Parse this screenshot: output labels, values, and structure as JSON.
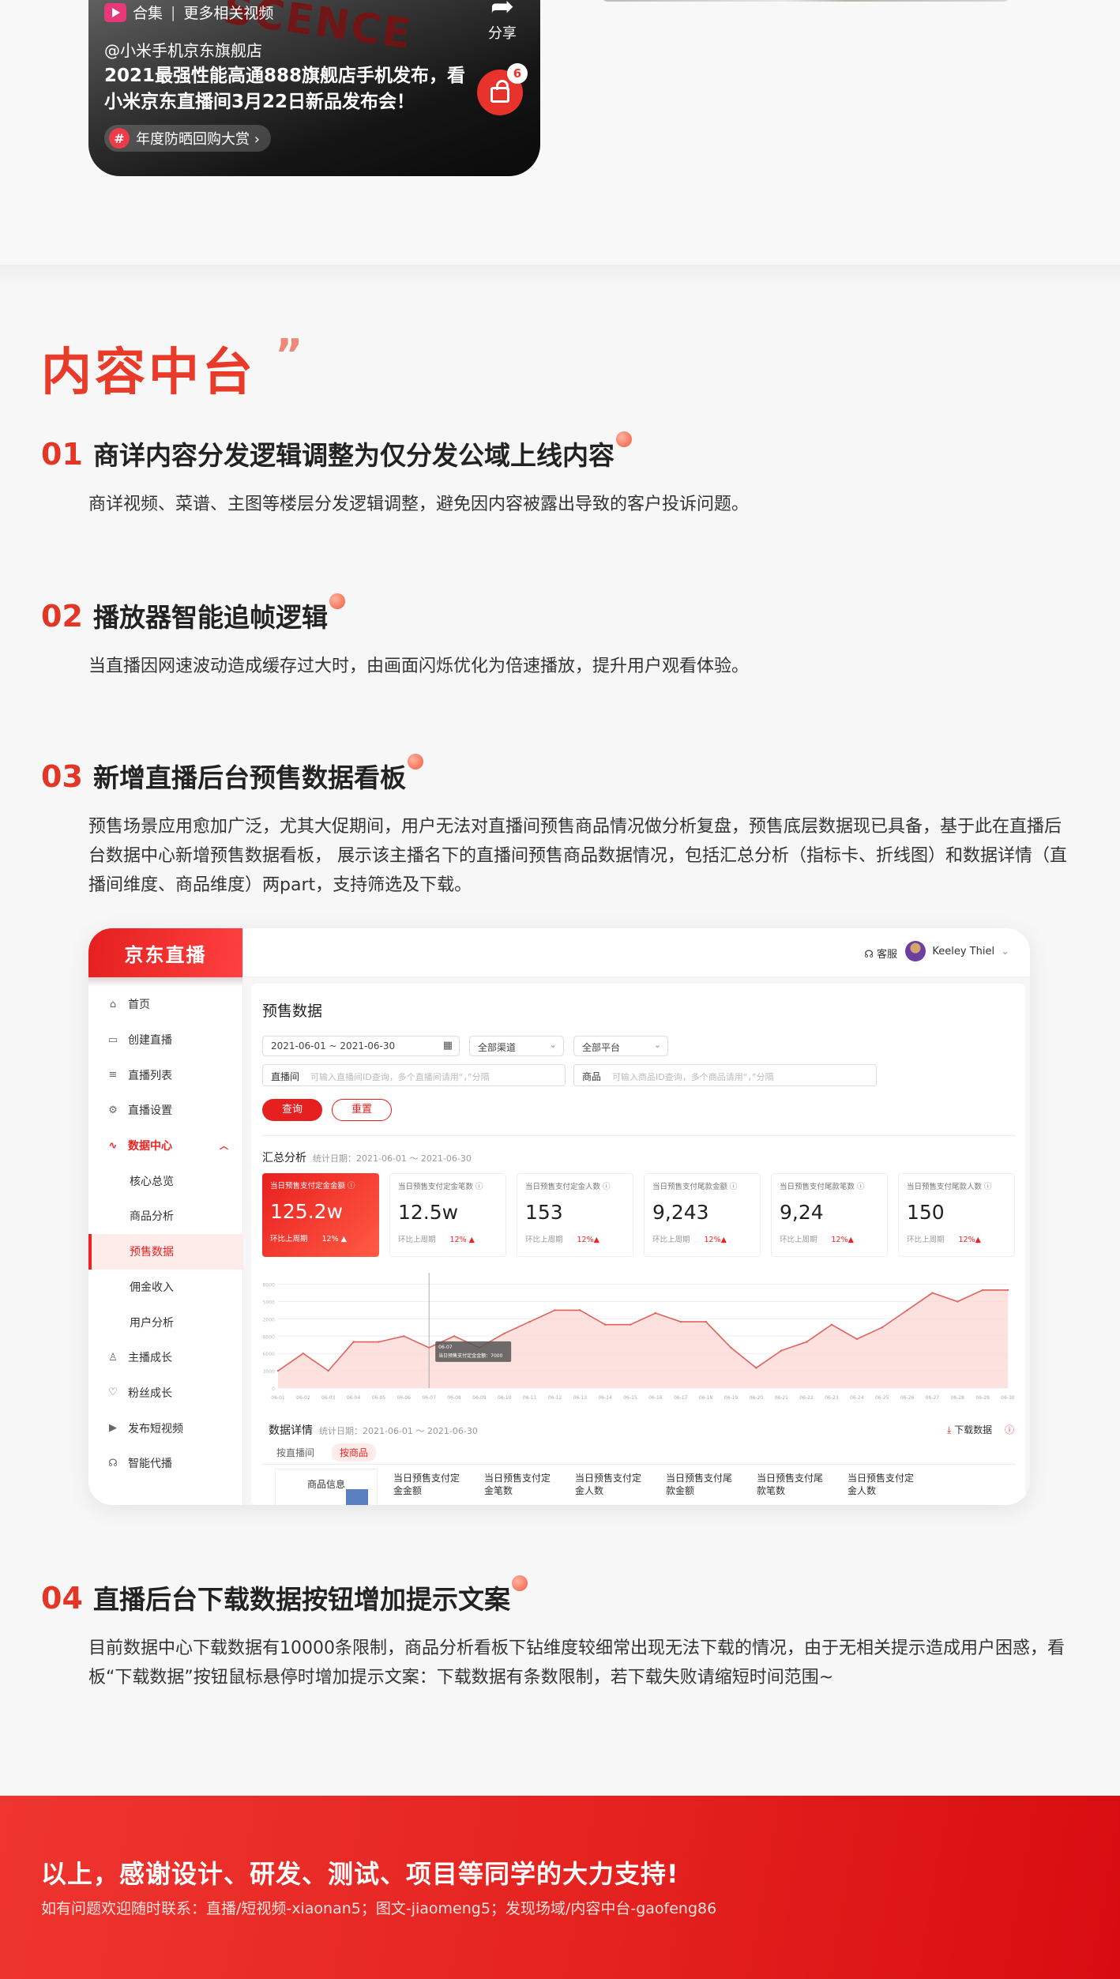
{
  "video_card": {
    "collection_label": "合集",
    "more_label": "更多相关视频",
    "bg_text": "SCENCE",
    "share_label": "分享",
    "author": "@小米手机京东旗舰店",
    "headline": "2021最强性能高通888旗舰店手机发布，看小米京东直播间3月22日新品发布会！",
    "cart_badge": "6",
    "topic_hash": "#",
    "topic_label": "年度防晒回购大赏 ›"
  },
  "section": {
    "title": "内容中台",
    "quote": "”"
  },
  "items": [
    {
      "num": "01",
      "title": "商详内容分发逻辑调整为仅分发公域上线内容",
      "body": "商详视频、菜谱、主图等楼层分发逻辑调整，避免因内容被露出导致的客户投诉问题。"
    },
    {
      "num": "02",
      "title": "播放器智能追帧逻辑",
      "body": "当直播因网速波动造成缓存过大时，由画面闪烁优化为倍速播放，提升用户观看体验。"
    },
    {
      "num": "03",
      "title": "新增直播后台预售数据看板",
      "body": "预售场景应用愈加广泛，尤其大促期间，用户无法对直播间预售商品情况做分析复盘，预售底层数据现已具备，基于此在直播后台数据中心新增预售数据看板， 展示该主播名下的直播间预售商品数据情况，包括汇总分析（指标卡、折线图）和数据详情（直播间维度、商品维度）两part，支持筛选及下载。"
    },
    {
      "num": "04",
      "title": "直播后台下载数据按钮增加提示文案",
      "body": "目前数据中心下载数据有10000条限制，商品分析看板下钻维度较细常出现无法下载的情况，由于无相关提示造成用户困惑，看板“下载数据”按钮鼠标悬停时增加提示文案：下载数据有条数限制，若下载失败请缩短时间范围~"
    }
  ],
  "dashboard": {
    "logo": "京东直播",
    "nav": [
      {
        "icon": "⌂",
        "label": "首页"
      },
      {
        "icon": "▭",
        "label": "创建直播"
      },
      {
        "icon": "≡",
        "label": "直播列表"
      },
      {
        "icon": "⚙",
        "label": "直播设置"
      },
      {
        "icon": "∿",
        "label": "数据中心",
        "caret": "︿"
      },
      {
        "label": "核心总览"
      },
      {
        "label": "商品分析"
      },
      {
        "label": "预售数据"
      },
      {
        "label": "佣金收入"
      },
      {
        "label": "用户分析"
      },
      {
        "icon": "♙",
        "label": "主播成长"
      },
      {
        "icon": "♡",
        "label": "粉丝成长"
      },
      {
        "icon": "▶",
        "label": "发布短视频"
      },
      {
        "icon": "☊",
        "label": "智能代播"
      }
    ],
    "help": "☊ 客服",
    "user": "Keeley Thiel",
    "user_caret": "⌄",
    "page_title": "预售数据",
    "date_range": "2021-06-01 ~ 2021-06-30",
    "date_icon": "▦",
    "channel": "全部渠道",
    "platform": "全部平台",
    "dropdown_icon": "⌄",
    "room_label": "直播间",
    "room_placeholder": "可输入直播间ID查询，多个直播间请用“，”分隔",
    "goods_label": "商品",
    "goods_placeholder": "可输入商品ID查询，多个商品请用“，”分隔",
    "query_btn": "查询",
    "reset_btn": "重置",
    "summary_title": "汇总分析",
    "stat_date": "统计日期：2021-06-01 ～ 2021-06-30",
    "kpis": [
      {
        "label": "当日预售支付定金金额 ⓘ",
        "value": "125.2w",
        "compare": "环比上周期",
        "pct": "12% ▲"
      },
      {
        "label": "当日预售支付定金笔数 ⓘ",
        "value": "12.5w",
        "compare": "环比上周期",
        "pct": "12% ▲"
      },
      {
        "label": "当日预售支付定金人数 ⓘ",
        "value": "153",
        "compare": "环比上周期",
        "pct": "12%▲"
      },
      {
        "label": "当日预售支付尾款金额 ⓘ",
        "value": "9,243",
        "compare": "环比上周期",
        "pct": "12%▲"
      },
      {
        "label": "当日预售支付尾款笔数 ⓘ",
        "value": "9,24",
        "compare": "环比上周期",
        "pct": "12%▲"
      },
      {
        "label": "当日预售支付尾款人数 ⓘ",
        "value": "150",
        "compare": "环比上周期",
        "pct": "12%▲"
      }
    ],
    "tooltip_date": "06-07",
    "tooltip_text": "当日预售支付定金金额：7000",
    "detail_title": "数据详情",
    "detail_date": "统计日期：2021-06-01 ～ 2021-06-30",
    "download_btn": "下载数据",
    "download_icon": "⤓",
    "help_icon": "ⓘ",
    "tabs": [
      "按直播间",
      "按商品"
    ],
    "table_col1": "商品信息",
    "table_cols": [
      "当日预售支付定金金额",
      "当日预售支付定金笔数",
      "当日预售支付定金人数",
      "当日预售支付尾款金额",
      "当日预售支付尾款笔数",
      "当日预售支付定金人数"
    ]
  },
  "chart_data": {
    "type": "area",
    "x": [
      "06-01",
      "06-02",
      "06-03",
      "06-04",
      "06-05",
      "06-06",
      "06-07",
      "06-08",
      "06-09",
      "06-10",
      "06-11",
      "06-12",
      "06-13",
      "06-14",
      "06-15",
      "06-16",
      "06-17",
      "06-18",
      "06-19",
      "06-20",
      "06-21",
      "06-22",
      "06-23",
      "06-24",
      "06-25",
      "06-26",
      "06-27",
      "06-28",
      "06-29",
      "06-30"
    ],
    "values": [
      3000,
      6000,
      3000,
      8000,
      8000,
      9000,
      7000,
      9000,
      7000,
      9500,
      11500,
      13500,
      13500,
      11000,
      11000,
      13000,
      11500,
      11500,
      7000,
      3500,
      6500,
      8000,
      11000,
      8500,
      10500,
      13500,
      16500,
      15000,
      17000,
      17000
    ],
    "ylim": [
      0,
      20000
    ],
    "yticks": [
      0,
      3000,
      6000,
      9000,
      12000,
      15000,
      18000
    ],
    "colors": {
      "line": "#e0625a",
      "fill": "#fbdad7"
    }
  },
  "footer": {
    "title": "以上，感谢设计、研发、测试、项目等同学的大力支持!",
    "contacts": "如有问题欢迎随时联系：直播/短视频-xiaonan5；图文-jiaomeng5；发现场域/内容中台-gaofeng86"
  }
}
